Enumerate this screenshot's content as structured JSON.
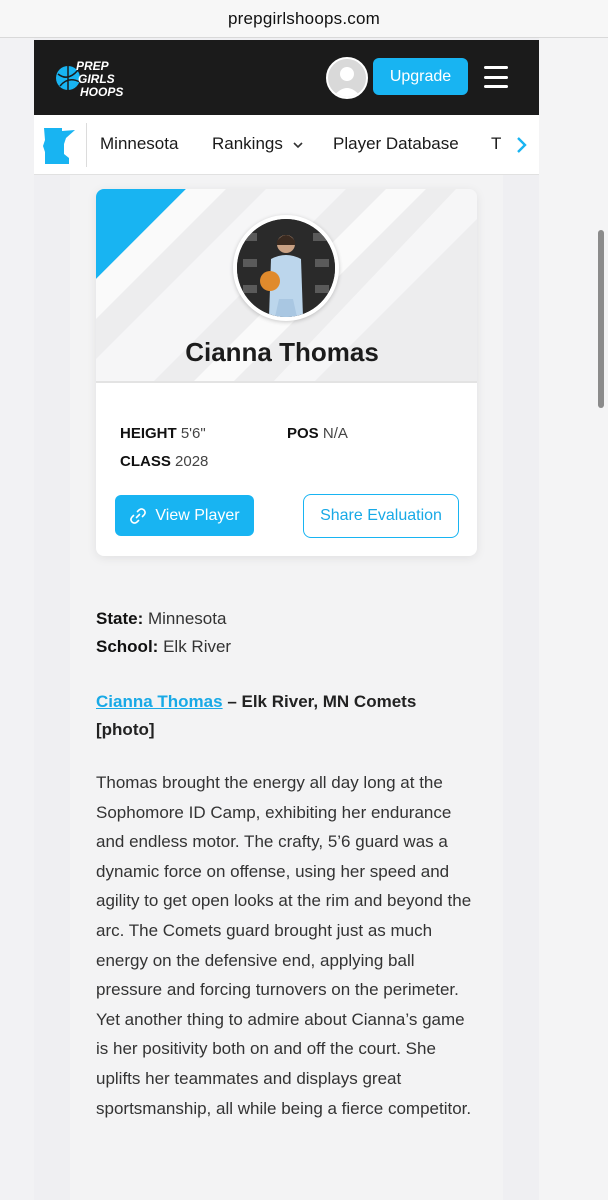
{
  "browser": {
    "url": "prepgirlshoops.com"
  },
  "header": {
    "logo_lines": [
      "PREP",
      "GIRLS",
      "HOOPS"
    ],
    "upgrade_label": "Upgrade",
    "brand_color": "#18b4f2"
  },
  "subnav": {
    "items": [
      {
        "label": "Minnesota"
      },
      {
        "label": "Rankings"
      },
      {
        "label": "Player Database"
      },
      {
        "label": "T"
      }
    ]
  },
  "player": {
    "name": "Cianna Thomas",
    "height_label": "HEIGHT",
    "height_value": "5'6\"",
    "pos_label": "POS",
    "pos_value": "N/A",
    "class_label": "CLASS",
    "class_value": "2028",
    "view_button": "View Player",
    "share_button": "Share Evaluation"
  },
  "article": {
    "state_label": "State:",
    "state_value": "Minnesota",
    "school_label": "School:",
    "school_value": "Elk River",
    "headline_link": "Cianna Thomas",
    "headline_rest": " – Elk River, MN Comets [photo]",
    "body": "Thomas brought the energy all day long at the Sophomore ID Camp, exhibiting her endurance and endless motor. The crafty, 5’6 guard was a dynamic force on offense, using her speed and agility to get open looks at the rim and beyond the arc. The Comets guard brought just as much energy on the defensive end, applying ball pressure and forcing turnovers on the perimeter. Yet another thing to admire about Cianna’s game is her positivity both on and off the court. She uplifts her teammates and displays great sportsmanship, all while being a fierce competitor."
  }
}
